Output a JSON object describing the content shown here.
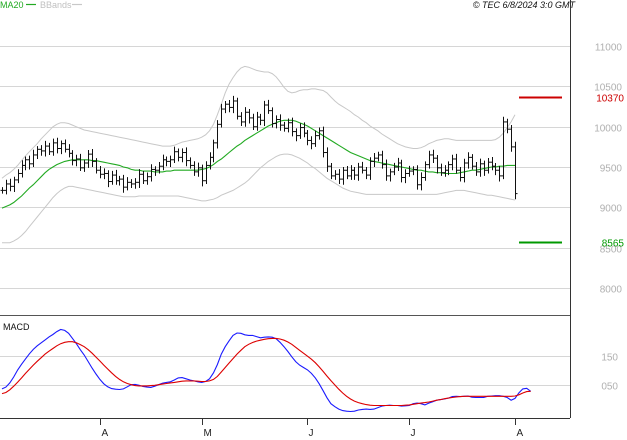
{
  "header": {
    "legend": [
      {
        "label": "MA20",
        "color": "#22aa22"
      },
      {
        "label": "BBands",
        "color": "#c8c8c8"
      }
    ],
    "stamp": "© TEC 6/8/2024 3:0 GMT"
  },
  "chart_data": [
    {
      "type": "candlestick",
      "title": "",
      "ylim": [
        7700,
        11400
      ],
      "y_ticks": [
        {
          "value": 11000,
          "label": "11000"
        },
        {
          "value": 10500,
          "label": "10500"
        },
        {
          "value": 10000,
          "label": "10000"
        },
        {
          "value": 9500,
          "label": "9500"
        },
        {
          "value": 9000,
          "label": "9000"
        },
        {
          "value": 8500,
          "label": "8500"
        },
        {
          "value": 8000,
          "label": "8000"
        }
      ],
      "x_ticks": [
        "A",
        "M",
        "J",
        "J",
        "A"
      ],
      "x_tick_index": [
        25,
        51,
        78,
        104,
        131
      ],
      "grid": true,
      "levels": [
        {
          "value": 10370,
          "label": "10370",
          "color": "#cc0000"
        },
        {
          "value": 8565,
          "label": "8565",
          "color": "#009900"
        }
      ],
      "closes": [
        9210,
        9290,
        9260,
        9340,
        9420,
        9520,
        9590,
        9540,
        9650,
        9720,
        9700,
        9760,
        9690,
        9800,
        9730,
        9790,
        9720,
        9670,
        9580,
        9600,
        9490,
        9550,
        9660,
        9570,
        9460,
        9410,
        9420,
        9320,
        9400,
        9330,
        9350,
        9250,
        9310,
        9290,
        9310,
        9410,
        9330,
        9380,
        9470,
        9460,
        9510,
        9590,
        9570,
        9590,
        9690,
        9620,
        9680,
        9580,
        9520,
        9440,
        9490,
        9330,
        9520,
        9620,
        9800,
        10030,
        10220,
        10280,
        10240,
        10320,
        10130,
        10060,
        10180,
        10110,
        10000,
        10120,
        10080,
        10270,
        10200,
        10040,
        10090,
        10020,
        9980,
        10050,
        9940,
        9890,
        9990,
        9920,
        9830,
        9790,
        9890,
        9950,
        9680,
        9510,
        9390,
        9410,
        9350,
        9460,
        9390,
        9460,
        9400,
        9500,
        9460,
        9400,
        9570,
        9610,
        9650,
        9530,
        9390,
        9440,
        9500,
        9550,
        9370,
        9420,
        9450,
        9470,
        9280,
        9370,
        9530,
        9650,
        9610,
        9490,
        9430,
        9460,
        9530,
        9600,
        9460,
        9370,
        9550,
        9620,
        9510,
        9440,
        9540,
        9460,
        9560,
        9510,
        9460,
        9390,
        10060,
        9970,
        9750,
        9170
      ],
      "ma20": [
        8990,
        9010,
        9030,
        9060,
        9100,
        9140,
        9190,
        9240,
        9280,
        9330,
        9380,
        9430,
        9470,
        9500,
        9530,
        9550,
        9570,
        9580,
        9590,
        9590,
        9590,
        9590,
        9590,
        9580,
        9580,
        9570,
        9560,
        9550,
        9540,
        9530,
        9520,
        9500,
        9490,
        9470,
        9460,
        9460,
        9450,
        9450,
        9450,
        9440,
        9440,
        9440,
        9450,
        9450,
        9460,
        9460,
        9460,
        9460,
        9460,
        9460,
        9460,
        9470,
        9480,
        9500,
        9530,
        9570,
        9600,
        9640,
        9680,
        9720,
        9760,
        9790,
        9830,
        9860,
        9890,
        9920,
        9950,
        9980,
        10010,
        10030,
        10050,
        10070,
        10080,
        10080,
        10080,
        10070,
        10050,
        10030,
        10010,
        9980,
        9950,
        9920,
        9890,
        9860,
        9830,
        9800,
        9770,
        9740,
        9710,
        9680,
        9660,
        9640,
        9620,
        9600,
        9580,
        9570,
        9560,
        9550,
        9540,
        9530,
        9520,
        9510,
        9500,
        9490,
        9480,
        9470,
        9460,
        9460,
        9450,
        9440,
        9440,
        9430,
        9430,
        9420,
        9420,
        9420,
        9420,
        9430,
        9440,
        9450,
        9460,
        9460,
        9470,
        9480,
        9490,
        9500,
        9500,
        9510,
        9510,
        9520,
        9520,
        9520
      ],
      "bb_upper": [
        9360,
        9400,
        9430,
        9470,
        9520,
        9580,
        9640,
        9690,
        9740,
        9790,
        9850,
        9900,
        9950,
        10000,
        10030,
        10050,
        10050,
        10040,
        10020,
        10000,
        9980,
        9960,
        9950,
        9940,
        9930,
        9920,
        9910,
        9900,
        9890,
        9880,
        9870,
        9860,
        9850,
        9840,
        9830,
        9820,
        9810,
        9800,
        9790,
        9780,
        9770,
        9760,
        9760,
        9760,
        9770,
        9790,
        9810,
        9820,
        9830,
        9840,
        9850,
        9870,
        9900,
        9950,
        10030,
        10150,
        10280,
        10420,
        10530,
        10610,
        10680,
        10730,
        10750,
        10740,
        10720,
        10700,
        10690,
        10680,
        10680,
        10660,
        10620,
        10560,
        10490,
        10440,
        10420,
        10430,
        10450,
        10460,
        10460,
        10470,
        10470,
        10460,
        10450,
        10420,
        10370,
        10320,
        10280,
        10250,
        10220,
        10190,
        10150,
        10120,
        10080,
        10050,
        10010,
        9980,
        9950,
        9910,
        9880,
        9850,
        9820,
        9790,
        9770,
        9750,
        9740,
        9730,
        9730,
        9740,
        9760,
        9790,
        9810,
        9830,
        9840,
        9850,
        9850,
        9840,
        9830,
        9830,
        9830,
        9830,
        9830,
        9830,
        9830,
        9830,
        9830,
        9830,
        9840,
        9870,
        9920,
        9990,
        10060,
        10150
      ],
      "bb_lower": [
        8560,
        8560,
        8560,
        8580,
        8610,
        8650,
        8700,
        8760,
        8820,
        8880,
        8940,
        9000,
        9060,
        9120,
        9170,
        9210,
        9240,
        9260,
        9260,
        9250,
        9240,
        9230,
        9220,
        9210,
        9200,
        9190,
        9180,
        9170,
        9160,
        9150,
        9140,
        9130,
        9130,
        9130,
        9130,
        9140,
        9140,
        9140,
        9140,
        9140,
        9140,
        9140,
        9140,
        9140,
        9140,
        9140,
        9130,
        9120,
        9110,
        9100,
        9090,
        9080,
        9080,
        9090,
        9100,
        9120,
        9150,
        9170,
        9190,
        9210,
        9240,
        9270,
        9300,
        9340,
        9390,
        9440,
        9490,
        9530,
        9570,
        9600,
        9630,
        9650,
        9660,
        9660,
        9650,
        9630,
        9610,
        9580,
        9550,
        9510,
        9480,
        9440,
        9400,
        9360,
        9330,
        9300,
        9270,
        9240,
        9220,
        9200,
        9190,
        9180,
        9170,
        9160,
        9160,
        9160,
        9160,
        9160,
        9160,
        9160,
        9160,
        9160,
        9160,
        9160,
        9160,
        9160,
        9160,
        9160,
        9160,
        9160,
        9160,
        9160,
        9170,
        9180,
        9190,
        9200,
        9210,
        9210,
        9210,
        9200,
        9190,
        9180,
        9170,
        9160,
        9150,
        9150,
        9140,
        9130,
        9120,
        9110,
        9100,
        9090
      ]
    },
    {
      "type": "line",
      "title": "MACD",
      "ylim": [
        -60,
        280
      ],
      "y_ticks": [
        {
          "value": 150,
          "label": "150"
        },
        {
          "value": 50,
          "label": "050"
        }
      ],
      "x_ticks": [
        "A",
        "M",
        "J",
        "J",
        "A"
      ],
      "series": [
        {
          "color": "#1a1aff",
          "values": [
            38,
            44,
            58,
            78,
            102,
            121,
            139,
            156,
            171,
            183,
            193,
            203,
            213,
            221,
            231,
            238,
            235,
            225,
            208,
            190,
            170,
            152,
            130,
            108,
            88,
            70,
            55,
            45,
            39,
            37,
            36,
            38,
            45,
            52,
            53,
            50,
            46,
            44,
            43,
            47,
            52,
            57,
            60,
            62,
            68,
            75,
            76,
            72,
            68,
            65,
            62,
            60,
            63,
            72,
            92,
            120,
            155,
            180,
            200,
            218,
            226,
            225,
            220,
            218,
            218,
            214,
            210,
            212,
            213,
            212,
            207,
            195,
            180,
            164,
            146,
            130,
            118,
            110,
            102,
            90,
            75,
            55,
            32,
            8,
            -12,
            -22,
            -30,
            -35,
            -37,
            -38,
            -37,
            -33,
            -31,
            -30,
            -31,
            -30,
            -25,
            -20,
            -18,
            -17,
            -18,
            -18,
            -20,
            -19,
            -18,
            -12,
            -10,
            -12,
            -16,
            -10,
            -5,
            0,
            2,
            4,
            7,
            12,
            13,
            12,
            13,
            14,
            10,
            9,
            9,
            9,
            13,
            14,
            15,
            15,
            13,
            9,
            0,
            6,
            25,
            38,
            40,
            30
          ]
        },
        {
          "color": "#dd0000",
          "values": [
            22,
            26,
            35,
            47,
            61,
            75,
            90,
            104,
            118,
            131,
            143,
            155,
            165,
            174,
            183,
            190,
            195,
            197,
            197,
            193,
            187,
            180,
            170,
            158,
            145,
            132,
            118,
            105,
            92,
            80,
            70,
            62,
            56,
            52,
            49,
            48,
            48,
            48,
            49,
            50,
            52,
            54,
            56,
            58,
            60,
            62,
            64,
            65,
            65,
            65,
            64,
            63,
            63,
            65,
            70,
            80,
            95,
            110,
            125,
            140,
            155,
            168,
            180,
            188,
            194,
            199,
            202,
            205,
            207,
            208,
            208,
            206,
            202,
            196,
            188,
            178,
            168,
            158,
            148,
            138,
            126,
            112,
            97,
            81,
            66,
            51,
            37,
            24,
            13,
            4,
            -3,
            -8,
            -12,
            -15,
            -17,
            -18,
            -18,
            -18,
            -18,
            -18,
            -18,
            -18,
            -18,
            -17,
            -16,
            -14,
            -12,
            -10,
            -8,
            -6,
            -3,
            0,
            2,
            5,
            7,
            9,
            11,
            12,
            13,
            13,
            13,
            13,
            13,
            13,
            13,
            13,
            13,
            13,
            13,
            13,
            13,
            14,
            18,
            24,
            29,
            30
          ]
        }
      ]
    }
  ]
}
